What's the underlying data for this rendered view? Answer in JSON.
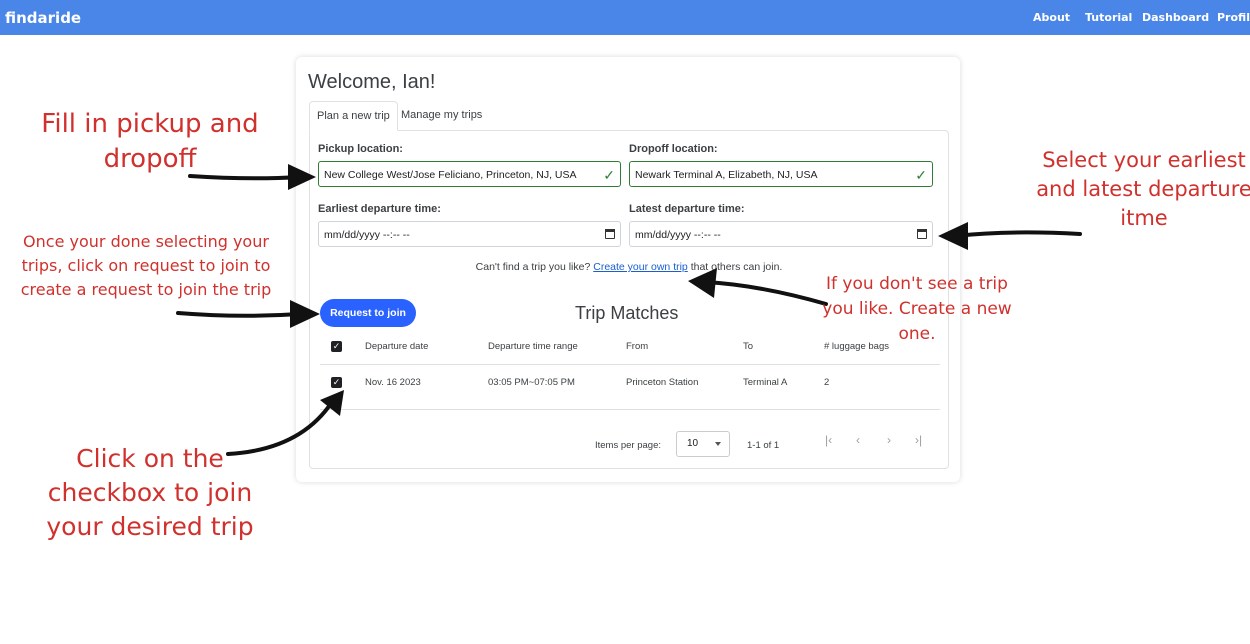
{
  "navbar": {
    "brand": "findaride",
    "links": [
      "About",
      "Tutorial",
      "Dashboard",
      "Profile"
    ]
  },
  "card": {
    "welcome": "Welcome, Ian!",
    "tabs": [
      "Plan a new trip",
      "Manage my trips"
    ],
    "pickup": {
      "label": "Pickup location:",
      "value": "New College West/Jose Feliciano, Princeton, NJ, USA"
    },
    "dropoff": {
      "label": "Dropoff location:",
      "value": "Newark Terminal A, Elizabeth, NJ, USA"
    },
    "earliest": {
      "label": "Earliest departure time:",
      "value": "mm/dd/yyyy --:-- --"
    },
    "latest": {
      "label": "Latest departure time:",
      "value": "mm/dd/yyyy --:-- --"
    },
    "hint_before": "Can't find a trip you like?",
    "hint_link": "Create your own trip",
    "hint_after": "that others can join.",
    "request_button": "Request to join",
    "matches_title": "Trip Matches",
    "table": {
      "headers": [
        "Departure date",
        "Departure time range",
        "From",
        "To",
        "# luggage bags"
      ],
      "rows": [
        [
          "Nov. 16 2023",
          "03:05 PM~07:05 PM",
          "Princeton Station",
          "Terminal A",
          "2"
        ]
      ]
    },
    "paginator": {
      "items_per_page_label": "Items per page:",
      "page_size": "10",
      "range": "1-1 of 1"
    }
  },
  "annotations": {
    "pickup": "Fill in pickup and dropoff",
    "times": "Select your earliest and latest departure itme",
    "request": "Once your done selecting your trips, click on request to join to create a request to join the trip",
    "create": "If you don't see a trip you like. Create a new one.",
    "checkbox": "Click on the checkbox to join your desired trip"
  },
  "colors": {
    "navbar": "#4a86e8",
    "accent_button": "#2962ff",
    "annotation": "#d0312d",
    "valid": "#2e7d32"
  }
}
